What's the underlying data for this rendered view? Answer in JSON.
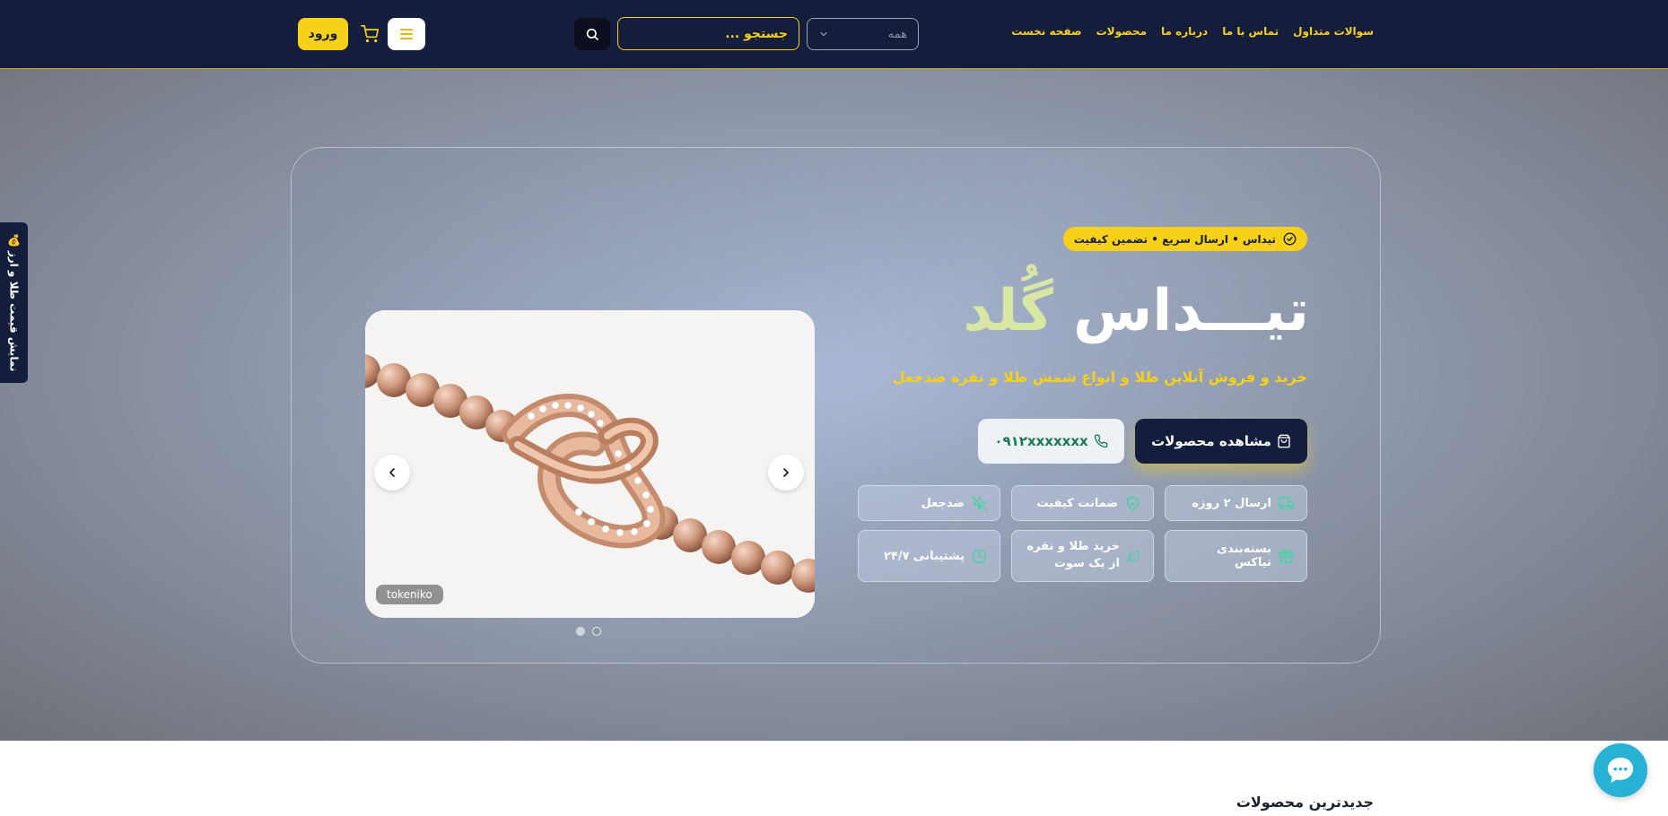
{
  "header": {
    "nav": [
      "صفحه نخست",
      "محصولات",
      "درباره ما",
      "تماس با ما",
      "سوالات متداول"
    ],
    "category_select": "همه",
    "search_placeholder": "جستجو ...",
    "login_label": "ورود"
  },
  "hero": {
    "badge": "تیداس • ارسال سریع • تضمین کیفیت",
    "brand_part1": "تیـــداس",
    "brand_part2": "گُلد",
    "tagline": "خرید و فروش آنلاین طلا و انواع شمش طلا و نقره ضدجعل",
    "cta_products": "مشاهده محصولات",
    "cta_phone": "۰۹۱۲xxxxxxx",
    "features": [
      "ارسال ۲ روزه",
      "ضمانت کیفیت",
      "ضدجعل",
      "بسته‌بندی تیاکس",
      "خرید طلا و نقره از یک سوت",
      "پشتیبانی ۲۴/۷"
    ]
  },
  "carousel": {
    "caption": "tokeniko",
    "slide_count": 2,
    "active_slide": 2
  },
  "side_tab": "نمایش قیمت طلا و ارز 💰",
  "sections": {
    "newest_title": "جدیدترین محصولات"
  },
  "colors": {
    "navy": "#141d3c",
    "gold": "#f7d117",
    "green": "#1a7a52",
    "chat": "#27b1d4"
  },
  "icons": {
    "cart": "cart-icon",
    "menu": "hamburger-icon",
    "search": "search-icon",
    "chevron": "chevron-down-icon",
    "badge": "check-circle-icon",
    "products": "shopping-bag-icon",
    "phone": "phone-icon",
    "shipping": "truck-icon",
    "quality": "shield-check-icon",
    "anti_fake": "zap-off-icon",
    "packaging": "gift-icon",
    "one_stop": "leaf-icon",
    "support": "clock-icon",
    "chat": "chat-bubble-icon"
  }
}
